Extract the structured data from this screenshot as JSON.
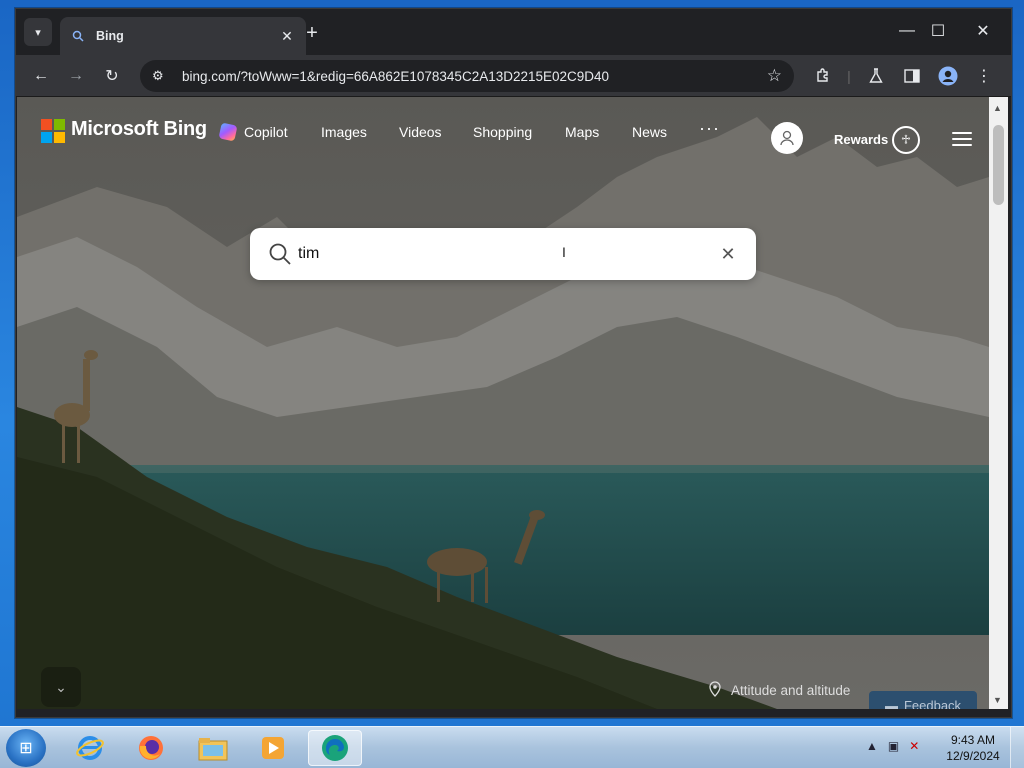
{
  "browser": {
    "tab_title": "Bing",
    "url": "bing.com/?toWww=1&redig=66A862E1078345C2A13D2215E02C9D40"
  },
  "bing": {
    "brand": "Microsoft Bing",
    "nav": [
      "Copilot",
      "Images",
      "Videos",
      "Shopping",
      "Maps",
      "News"
    ],
    "more": "···",
    "rewards": "Rewards",
    "search_value": "tim",
    "location_caption": "Attitude and altitude",
    "feedback": "Feedback"
  },
  "taskbar": {
    "time": "9:43 AM",
    "date": "12/9/2024"
  },
  "colors": {
    "ms_red": "#f25022",
    "ms_green": "#7fba00",
    "ms_blue": "#00a4ef",
    "ms_yellow": "#ffb900",
    "chrome_dark": "#202124",
    "chrome_toolbar": "#35363a"
  },
  "icons": [
    "search-icon",
    "close-icon",
    "star-icon",
    "extensions-icon",
    "labs-icon",
    "sidepanel-icon",
    "profile-icon",
    "menu-icon",
    "pin-icon",
    "feedback-icon"
  ]
}
